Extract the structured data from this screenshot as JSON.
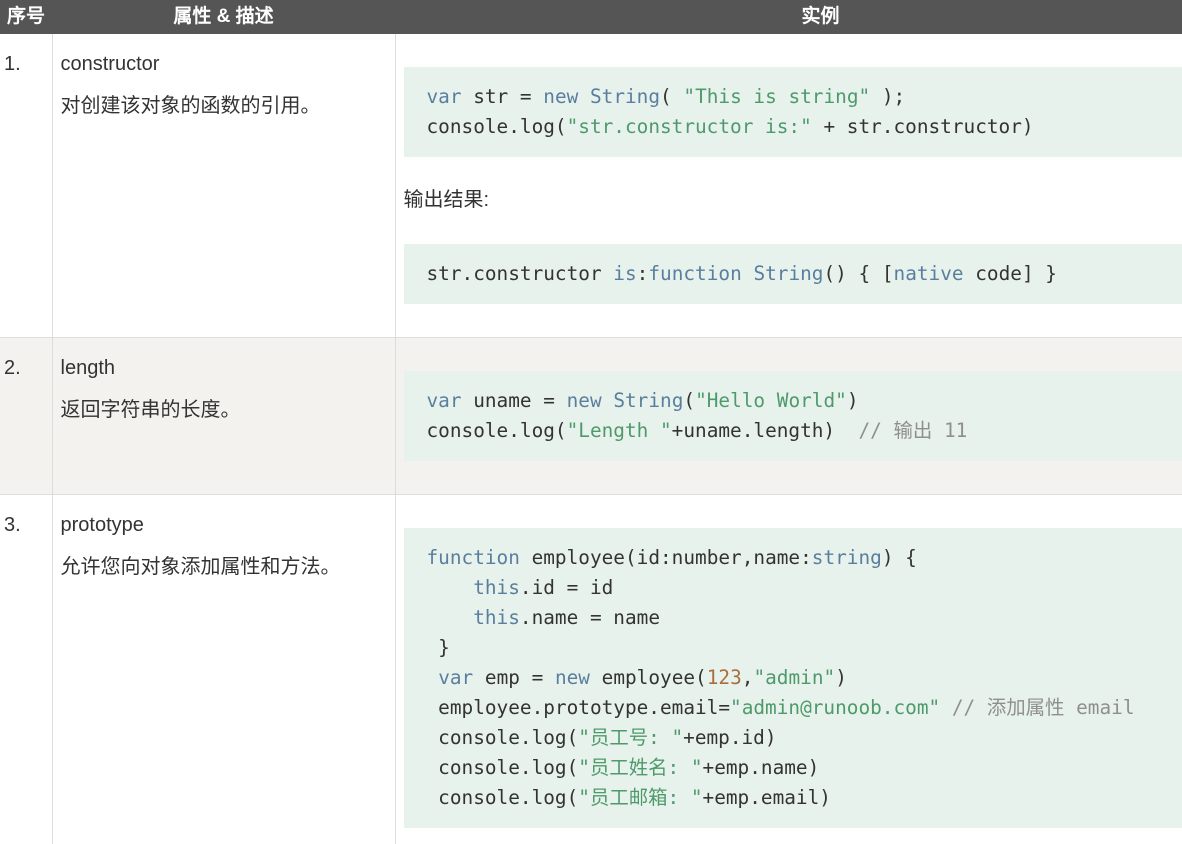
{
  "theme": {
    "header_bg": "#555555",
    "header_text": "#ffffff",
    "alt_row_bg": "#f3f2ee",
    "code_bg": "#e8f2ec",
    "rule": "#dddddd",
    "text": "#333333"
  },
  "header": {
    "index": "序号",
    "property": "属性 & 描述",
    "example": "实例"
  },
  "rows": [
    {
      "index": "1.",
      "name": "constructor",
      "description": "对创建该对象的函数的引用。",
      "code": [
        [
          {
            "t": "var",
            "c": "#5a7f9e"
          },
          {
            "t": " str = "
          },
          {
            "t": "new",
            "c": "#5a7f9e"
          },
          {
            "t": " "
          },
          {
            "t": "String",
            "c": "#5a7f9e"
          },
          {
            "t": "( "
          },
          {
            "t": "\"This is string\"",
            "c": "#4e9a6b"
          },
          {
            "t": " );"
          }
        ],
        [
          {
            "t": "console.log("
          },
          {
            "t": "\"str.constructor is:\"",
            "c": "#4e9a6b"
          },
          {
            "t": " + str.constructor)"
          }
        ]
      ],
      "output_label": "输出结果:",
      "output": [
        [
          {
            "t": "str.constructor "
          },
          {
            "t": "is",
            "c": "#5a7f9e"
          },
          {
            "t": ":"
          },
          {
            "t": "function",
            "c": "#5a7f9e"
          },
          {
            "t": " "
          },
          {
            "t": "String",
            "c": "#5a7f9e"
          },
          {
            "t": "() { ["
          },
          {
            "t": "native",
            "c": "#5a7f9e"
          },
          {
            "t": " code] }"
          }
        ]
      ]
    },
    {
      "index": "2.",
      "name": "length",
      "description": "返回字符串的长度。",
      "code": [
        [
          {
            "t": "var",
            "c": "#5a7f9e"
          },
          {
            "t": " uname = "
          },
          {
            "t": "new",
            "c": "#5a7f9e"
          },
          {
            "t": " "
          },
          {
            "t": "String",
            "c": "#5a7f9e"
          },
          {
            "t": "("
          },
          {
            "t": "\"Hello World\"",
            "c": "#4e9a6b"
          },
          {
            "t": ")"
          }
        ],
        [
          {
            "t": "console.log("
          },
          {
            "t": "\"Length \"",
            "c": "#4e9a6b"
          },
          {
            "t": "+uname.length)  "
          },
          {
            "t": "// 输出 11",
            "c": "#8f8f8f"
          }
        ]
      ]
    },
    {
      "index": "3.",
      "name": "prototype",
      "description": "允许您向对象添加属性和方法。",
      "code": [
        [
          {
            "t": "function",
            "c": "#5a7f9e"
          },
          {
            "t": " employee(id:number,name:"
          },
          {
            "t": "string",
            "c": "#5a7f9e"
          },
          {
            "t": ") {"
          }
        ],
        [
          {
            "t": "    "
          },
          {
            "t": "this",
            "c": "#5a7f9e"
          },
          {
            "t": ".id = id"
          }
        ],
        [
          {
            "t": "    "
          },
          {
            "t": "this",
            "c": "#5a7f9e"
          },
          {
            "t": ".name = name"
          }
        ],
        [
          {
            "t": " }"
          }
        ],
        [
          {
            "t": " "
          },
          {
            "t": "var",
            "c": "#5a7f9e"
          },
          {
            "t": " emp = "
          },
          {
            "t": "new",
            "c": "#5a7f9e"
          },
          {
            "t": " employee("
          },
          {
            "t": "123",
            "c": "#a86f3c"
          },
          {
            "t": ","
          },
          {
            "t": "\"admin\"",
            "c": "#4e9a6b"
          },
          {
            "t": ")"
          }
        ],
        [
          {
            "t": " employee.prototype.email="
          },
          {
            "t": "\"admin@runoob.com\"",
            "c": "#4e9a6b"
          },
          {
            "t": " "
          },
          {
            "t": "// 添加属性 email",
            "c": "#8f8f8f"
          }
        ],
        [
          {
            "t": " console.log("
          },
          {
            "t": "\"员工号: \"",
            "c": "#4e9a6b"
          },
          {
            "t": "+emp.id)"
          }
        ],
        [
          {
            "t": " console.log("
          },
          {
            "t": "\"员工姓名: \"",
            "c": "#4e9a6b"
          },
          {
            "t": "+emp.name)"
          }
        ],
        [
          {
            "t": " console.log("
          },
          {
            "t": "\"员工邮箱: \"",
            "c": "#4e9a6b"
          },
          {
            "t": "+emp.email)"
          }
        ]
      ]
    }
  ]
}
